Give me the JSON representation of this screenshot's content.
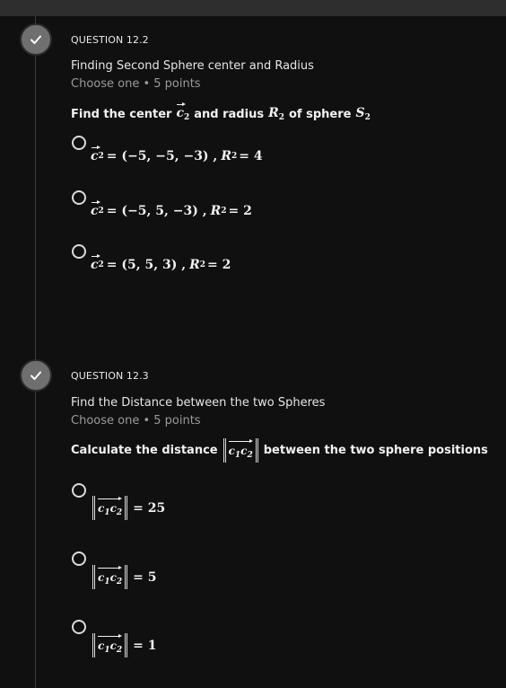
{
  "questions": [
    {
      "number": "QUESTION 12.2",
      "title": "Finding Second Sphere center and Radius",
      "meta": "Choose one • 5 points",
      "prompt_pre": "Find the center",
      "prompt_mid": "and radius",
      "prompt_post": "of sphere",
      "options": [
        {
          "c_values": "= (−5, −5, −3) ,",
          "r_value": "= 4"
        },
        {
          "c_values": "= (−5, 5, −3) ,",
          "r_value": "= 2"
        },
        {
          "c_values": "= (5, 5, 3) ,",
          "r_value": "= 2"
        }
      ]
    },
    {
      "number": "QUESTION 12.3",
      "title": "Find the Distance between the two Spheres",
      "meta": "Choose one • 5 points",
      "prompt_pre": "Calculate the distance",
      "prompt_post": "between the two sphere positions",
      "options": [
        {
          "value": "= 25"
        },
        {
          "value": "= 5"
        },
        {
          "value": "= 1"
        }
      ]
    }
  ],
  "math": {
    "c": "c",
    "c_sub_2": "2",
    "c_sub_1": "1",
    "R": "R",
    "S": "S"
  },
  "colors": {
    "background": "#101010",
    "check_circle": "#6f6f6f",
    "text": "#e6e6e6",
    "meta": "#9a9a9a"
  }
}
